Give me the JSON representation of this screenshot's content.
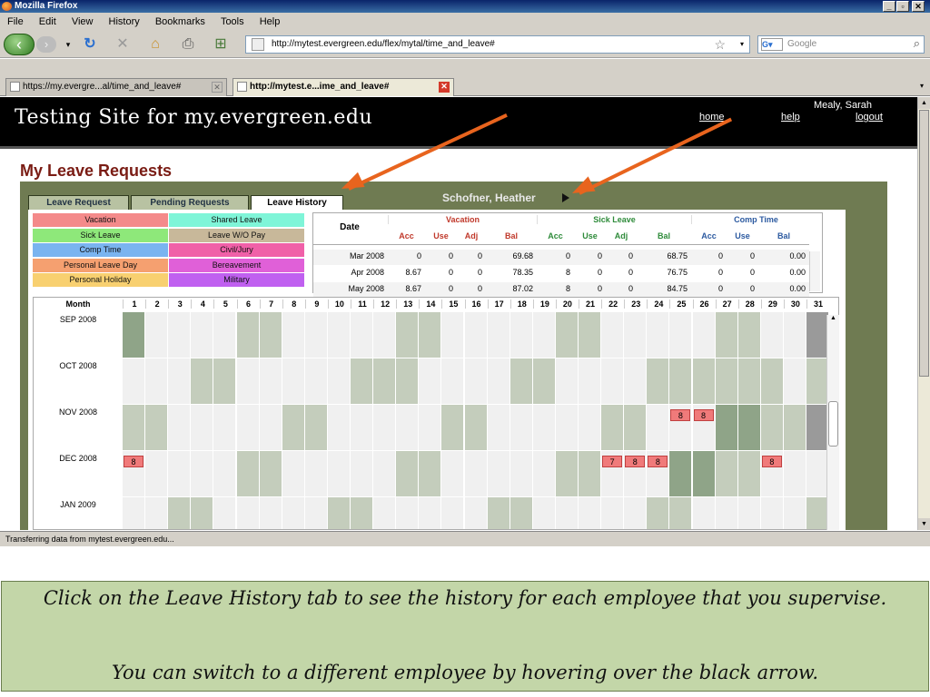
{
  "window": {
    "title": "Mozilla Firefox"
  },
  "menu": [
    "File",
    "Edit",
    "View",
    "History",
    "Bookmarks",
    "Tools",
    "Help"
  ],
  "nav": {
    "url": "http://mytest.evergreen.edu/flex/mytal/time_and_leave#",
    "search_placeholder": "Google"
  },
  "tabs": [
    {
      "label": "https://my.evergre...al/time_and_leave#"
    },
    {
      "label": "http://mytest.e...ime_and_leave#"
    }
  ],
  "status": "Transferring data from mytest.evergreen.edu...",
  "site": {
    "title": "Testing Site for my.evergreen.edu",
    "user": "Mealy, Sarah",
    "links": {
      "home": "home",
      "help": "help",
      "logout": "logout"
    }
  },
  "page": {
    "title": "My Leave Requests",
    "tabs": [
      "Leave Request",
      "Pending Requests",
      "Leave History"
    ],
    "employee": "Schofner, Heather"
  },
  "legend": [
    {
      "label": "Vacation",
      "color": "#f48a8a"
    },
    {
      "label": "Shared Leave",
      "color": "#7ff5d8"
    },
    {
      "label": "Sick Leave",
      "color": "#8ee87a"
    },
    {
      "label": "Leave W/O Pay",
      "color": "#c8b89a"
    },
    {
      "label": "Comp Time",
      "color": "#7ab4f0"
    },
    {
      "label": "Civil/Jury",
      "color": "#f060a8"
    },
    {
      "label": "Personal Leave Day",
      "color": "#f5a070"
    },
    {
      "label": "Bereavement",
      "color": "#e060d8"
    },
    {
      "label": "Personal Holiday",
      "color": "#f8d070"
    },
    {
      "label": "Military",
      "color": "#c060f0"
    }
  ],
  "summary": {
    "date_header": "Date",
    "groups": [
      {
        "label": "Vacation",
        "color": "#c0392b"
      },
      {
        "label": "Sick Leave",
        "color": "#2e8b3a"
      },
      {
        "label": "Comp Time",
        "color": "#2c5aa0"
      }
    ],
    "subheaders": [
      "Acc",
      "Use",
      "Adj",
      "Bal",
      "Acc",
      "Use",
      "Adj",
      "Bal",
      "Acc",
      "Use",
      "Bal"
    ],
    "rows": [
      {
        "date": "Mar 2008",
        "values": [
          "0",
          "0",
          "0",
          "69.68",
          "0",
          "0",
          "0",
          "68.75",
          "0",
          "0",
          "0.00"
        ]
      },
      {
        "date": "Apr 2008",
        "values": [
          "8.67",
          "0",
          "0",
          "78.35",
          "8",
          "0",
          "0",
          "76.75",
          "0",
          "0",
          "0.00"
        ]
      },
      {
        "date": "May 2008",
        "values": [
          "8.67",
          "0",
          "0",
          "87.02",
          "8",
          "0",
          "0",
          "84.75",
          "0",
          "0",
          "0.00"
        ]
      }
    ]
  },
  "calendar": {
    "month_header": "Month",
    "days": [
      "1",
      "2",
      "3",
      "4",
      "5",
      "6",
      "7",
      "8",
      "9",
      "10",
      "11",
      "12",
      "13",
      "14",
      "15",
      "16",
      "17",
      "18",
      "19",
      "20",
      "21",
      "22",
      "23",
      "24",
      "25",
      "26",
      "27",
      "28",
      "29",
      "30",
      "31"
    ],
    "months": [
      {
        "label": "SEP 2008",
        "entries": []
      },
      {
        "label": "OCT 2008",
        "entries": []
      },
      {
        "label": "NOV 2008",
        "entries": [
          {
            "day": 25,
            "value": "8"
          },
          {
            "day": 26,
            "value": "8"
          }
        ]
      },
      {
        "label": "DEC 2008",
        "entries": [
          {
            "day": 1,
            "value": "8"
          },
          {
            "day": 22,
            "value": "7"
          },
          {
            "day": 23,
            "value": "8"
          },
          {
            "day": 24,
            "value": "8"
          },
          {
            "day": 29,
            "value": "8"
          }
        ]
      },
      {
        "label": "JAN 2009",
        "entries": []
      }
    ]
  },
  "caption": {
    "line1": "Click on the Leave History tab to see the history for each employee that you supervise.",
    "line2": "You can switch to a different employee by hovering over the black arrow."
  }
}
